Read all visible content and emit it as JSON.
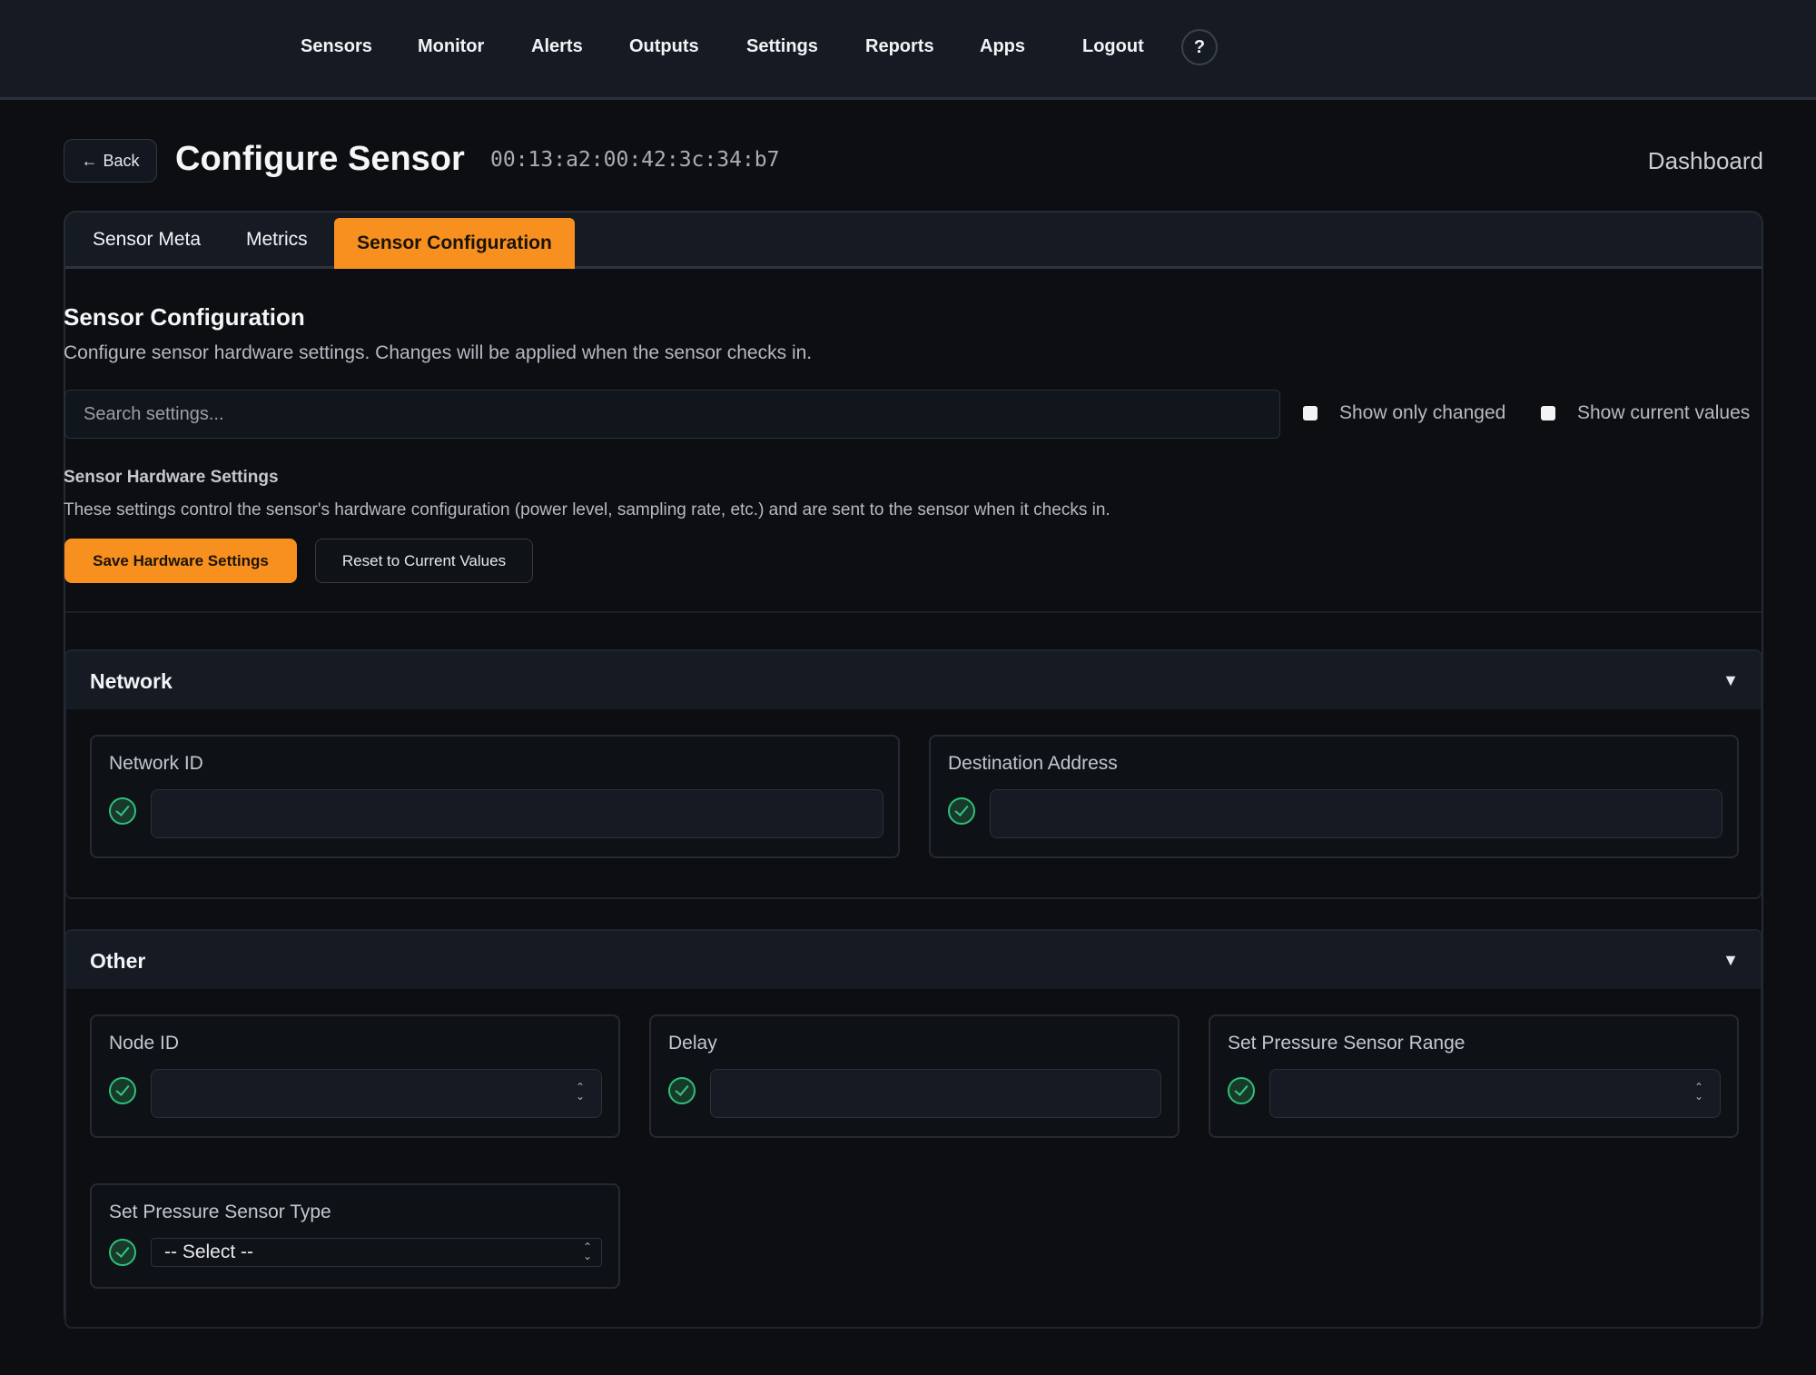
{
  "nav": {
    "items": [
      "Sensors",
      "Monitor",
      "Alerts",
      "Outputs",
      "Settings",
      "Reports",
      "Apps",
      "Logout"
    ],
    "help_label": "?"
  },
  "header": {
    "back_label": "Back",
    "title": "Configure Sensor",
    "sensor_mac": "00:13:a2:00:42:3c:34:b7",
    "dashboard_link": "Dashboard"
  },
  "tabs": {
    "items": [
      "Sensor Meta",
      "Metrics",
      "Sensor Configuration"
    ],
    "active": "Sensor Configuration"
  },
  "config": {
    "title": "Sensor Configuration",
    "description": "Configure sensor hardware settings. Changes will be applied when the sensor checks in.",
    "search_placeholder": "Search settings...",
    "show_only_changed_label": "Show only changed",
    "show_only_changed_checked": false,
    "show_current_values_label": "Show current values",
    "show_current_values_checked": false
  },
  "hardware": {
    "title": "Sensor Hardware Settings",
    "description": "These settings control the sensor's hardware configuration (power level, sampling rate, etc.) and are sent to the sensor when it checks in.",
    "save_label": "Save Hardware Settings",
    "reset_label": "Reset to Current Values"
  },
  "groups": [
    {
      "title": "Network",
      "fields": [
        {
          "label": "Network ID",
          "value": ""
        },
        {
          "label": "Destination Address",
          "value": ""
        }
      ]
    },
    {
      "title": "Other",
      "fields": [
        {
          "label": "Node ID",
          "value": ""
        },
        {
          "label": "Delay",
          "value": ""
        },
        {
          "label": "Set Pressure Sensor Range",
          "value": ""
        },
        {
          "label": "Set Pressure Sensor Type",
          "value": "-- Select --"
        }
      ]
    }
  ],
  "colors": {
    "accent": "#f7901e",
    "background": "#0c0e12",
    "panel": "#161b23",
    "valid": "#2fbf7a"
  }
}
